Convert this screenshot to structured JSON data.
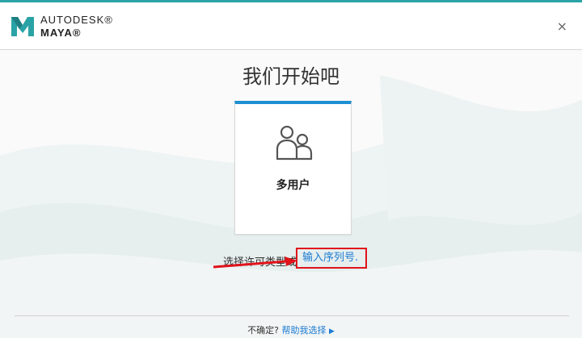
{
  "header": {
    "brand_top": "AUTODESK®",
    "brand_bottom": "MAYA®",
    "close_glyph": "×",
    "logo_icon": "maya-logo-icon"
  },
  "main": {
    "title": "我们开始吧",
    "card": {
      "label": "多用户",
      "icon": "users-icon",
      "accent_color": "#1e8fd3"
    },
    "choose_text": "选择许可类型或",
    "serial_link": "输入序列号."
  },
  "footer": {
    "unsure_text": "不确定?",
    "help_link": "帮助我选择",
    "arrow_glyph": "▶"
  },
  "colors": {
    "teal_accent": "#2aa3a6",
    "annotation_red": "#e0131b",
    "link_blue": "#1b7bd3"
  }
}
